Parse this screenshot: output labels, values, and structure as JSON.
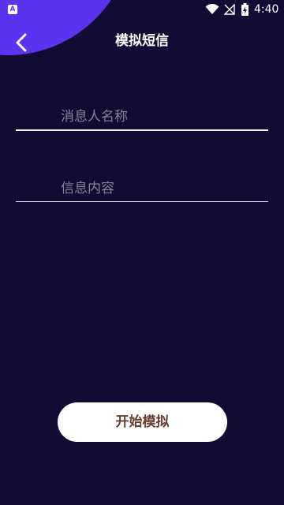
{
  "status_bar": {
    "app_icon_glyph": "A",
    "time": "4:40",
    "icons": [
      "wifi-icon",
      "signal-off-icon",
      "battery-charging-icon"
    ]
  },
  "toolbar": {
    "back_icon": "chevron-left-icon",
    "title": "模拟短信"
  },
  "form": {
    "name_placeholder": "消息人名称",
    "content_placeholder": "信息内容",
    "name_value": "",
    "content_value": ""
  },
  "actions": {
    "start_label": "开始模拟"
  },
  "colors": {
    "background": "#120b33",
    "accent": "#5b33f0",
    "button_bg": "#ffffff",
    "button_text": "#6a3e2e"
  }
}
